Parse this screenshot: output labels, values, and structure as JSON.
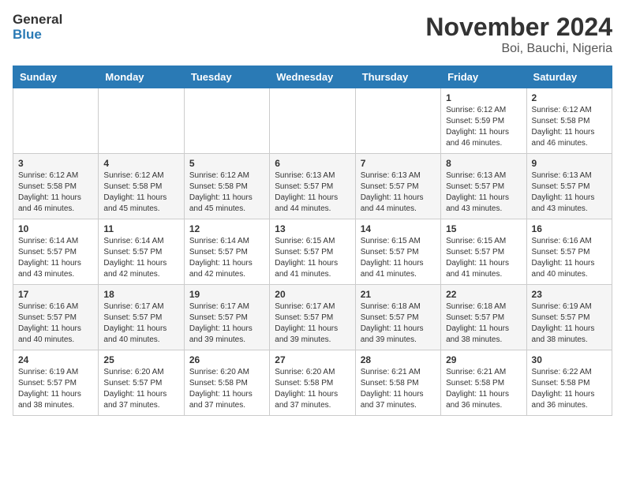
{
  "header": {
    "logo_line1": "General",
    "logo_line2": "Blue",
    "month_title": "November 2024",
    "location": "Boi, Bauchi, Nigeria"
  },
  "weekdays": [
    "Sunday",
    "Monday",
    "Tuesday",
    "Wednesday",
    "Thursday",
    "Friday",
    "Saturday"
  ],
  "weeks": [
    [
      {
        "num": "",
        "info": ""
      },
      {
        "num": "",
        "info": ""
      },
      {
        "num": "",
        "info": ""
      },
      {
        "num": "",
        "info": ""
      },
      {
        "num": "",
        "info": ""
      },
      {
        "num": "1",
        "info": "Sunrise: 6:12 AM\nSunset: 5:59 PM\nDaylight: 11 hours\nand 46 minutes."
      },
      {
        "num": "2",
        "info": "Sunrise: 6:12 AM\nSunset: 5:58 PM\nDaylight: 11 hours\nand 46 minutes."
      }
    ],
    [
      {
        "num": "3",
        "info": "Sunrise: 6:12 AM\nSunset: 5:58 PM\nDaylight: 11 hours\nand 46 minutes."
      },
      {
        "num": "4",
        "info": "Sunrise: 6:12 AM\nSunset: 5:58 PM\nDaylight: 11 hours\nand 45 minutes."
      },
      {
        "num": "5",
        "info": "Sunrise: 6:12 AM\nSunset: 5:58 PM\nDaylight: 11 hours\nand 45 minutes."
      },
      {
        "num": "6",
        "info": "Sunrise: 6:13 AM\nSunset: 5:57 PM\nDaylight: 11 hours\nand 44 minutes."
      },
      {
        "num": "7",
        "info": "Sunrise: 6:13 AM\nSunset: 5:57 PM\nDaylight: 11 hours\nand 44 minutes."
      },
      {
        "num": "8",
        "info": "Sunrise: 6:13 AM\nSunset: 5:57 PM\nDaylight: 11 hours\nand 43 minutes."
      },
      {
        "num": "9",
        "info": "Sunrise: 6:13 AM\nSunset: 5:57 PM\nDaylight: 11 hours\nand 43 minutes."
      }
    ],
    [
      {
        "num": "10",
        "info": "Sunrise: 6:14 AM\nSunset: 5:57 PM\nDaylight: 11 hours\nand 43 minutes."
      },
      {
        "num": "11",
        "info": "Sunrise: 6:14 AM\nSunset: 5:57 PM\nDaylight: 11 hours\nand 42 minutes."
      },
      {
        "num": "12",
        "info": "Sunrise: 6:14 AM\nSunset: 5:57 PM\nDaylight: 11 hours\nand 42 minutes."
      },
      {
        "num": "13",
        "info": "Sunrise: 6:15 AM\nSunset: 5:57 PM\nDaylight: 11 hours\nand 41 minutes."
      },
      {
        "num": "14",
        "info": "Sunrise: 6:15 AM\nSunset: 5:57 PM\nDaylight: 11 hours\nand 41 minutes."
      },
      {
        "num": "15",
        "info": "Sunrise: 6:15 AM\nSunset: 5:57 PM\nDaylight: 11 hours\nand 41 minutes."
      },
      {
        "num": "16",
        "info": "Sunrise: 6:16 AM\nSunset: 5:57 PM\nDaylight: 11 hours\nand 40 minutes."
      }
    ],
    [
      {
        "num": "17",
        "info": "Sunrise: 6:16 AM\nSunset: 5:57 PM\nDaylight: 11 hours\nand 40 minutes."
      },
      {
        "num": "18",
        "info": "Sunrise: 6:17 AM\nSunset: 5:57 PM\nDaylight: 11 hours\nand 40 minutes."
      },
      {
        "num": "19",
        "info": "Sunrise: 6:17 AM\nSunset: 5:57 PM\nDaylight: 11 hours\nand 39 minutes."
      },
      {
        "num": "20",
        "info": "Sunrise: 6:17 AM\nSunset: 5:57 PM\nDaylight: 11 hours\nand 39 minutes."
      },
      {
        "num": "21",
        "info": "Sunrise: 6:18 AM\nSunset: 5:57 PM\nDaylight: 11 hours\nand 39 minutes."
      },
      {
        "num": "22",
        "info": "Sunrise: 6:18 AM\nSunset: 5:57 PM\nDaylight: 11 hours\nand 38 minutes."
      },
      {
        "num": "23",
        "info": "Sunrise: 6:19 AM\nSunset: 5:57 PM\nDaylight: 11 hours\nand 38 minutes."
      }
    ],
    [
      {
        "num": "24",
        "info": "Sunrise: 6:19 AM\nSunset: 5:57 PM\nDaylight: 11 hours\nand 38 minutes."
      },
      {
        "num": "25",
        "info": "Sunrise: 6:20 AM\nSunset: 5:57 PM\nDaylight: 11 hours\nand 37 minutes."
      },
      {
        "num": "26",
        "info": "Sunrise: 6:20 AM\nSunset: 5:58 PM\nDaylight: 11 hours\nand 37 minutes."
      },
      {
        "num": "27",
        "info": "Sunrise: 6:20 AM\nSunset: 5:58 PM\nDaylight: 11 hours\nand 37 minutes."
      },
      {
        "num": "28",
        "info": "Sunrise: 6:21 AM\nSunset: 5:58 PM\nDaylight: 11 hours\nand 37 minutes."
      },
      {
        "num": "29",
        "info": "Sunrise: 6:21 AM\nSunset: 5:58 PM\nDaylight: 11 hours\nand 36 minutes."
      },
      {
        "num": "30",
        "info": "Sunrise: 6:22 AM\nSunset: 5:58 PM\nDaylight: 11 hours\nand 36 minutes."
      }
    ]
  ]
}
